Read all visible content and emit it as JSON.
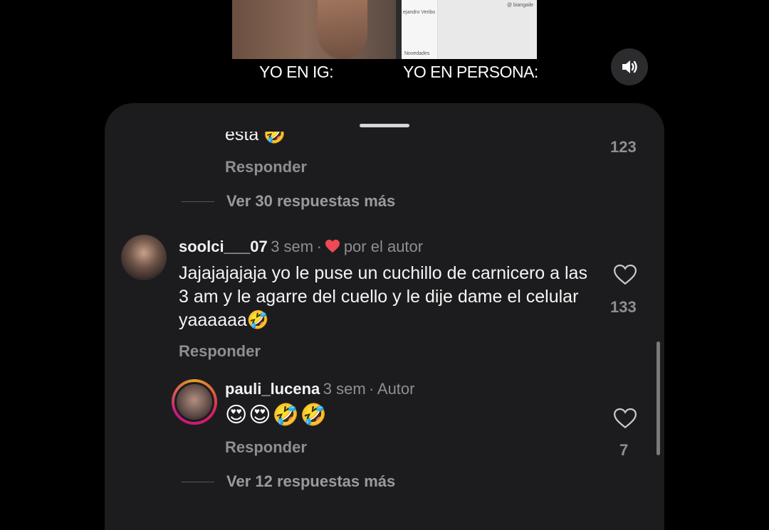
{
  "video": {
    "caption_left": "YO EN IG:",
    "caption_right": "YO EN PERSONA:",
    "screen_name_partial": "ejandro Veribo",
    "screen_handle_partial": "@ biangaile",
    "screen_label": "Novedades"
  },
  "sound_icon": "speaker-icon",
  "comments": {
    "top_partial": {
      "text": "esta 🤣",
      "reply_label": "Responder",
      "like_count": "123",
      "more_replies": "Ver 30 respuestas más"
    },
    "main": {
      "username": "soolci___07",
      "time": "3 sem",
      "separator": "·",
      "liked_by_author": "por el autor",
      "text": "Jajajajajaja yo le puse un cuchillo de carnicero a las 3 am y le agarre del cuello y le dije dame el celular yaaaaaa🤣",
      "reply_label": "Responder",
      "like_count": "133"
    },
    "reply": {
      "username": "pauli_lucena",
      "time": "3 sem",
      "separator": "·",
      "author_badge": "Autor",
      "text": "😍😍🤣🤣",
      "reply_label": "Responder",
      "like_count": "7"
    },
    "more_replies_bottom": "Ver 12 respuestas más"
  },
  "colors": {
    "sheet_bg": "#1c1c1e",
    "heart_red": "#ed4956",
    "muted": "#8e8e93"
  }
}
